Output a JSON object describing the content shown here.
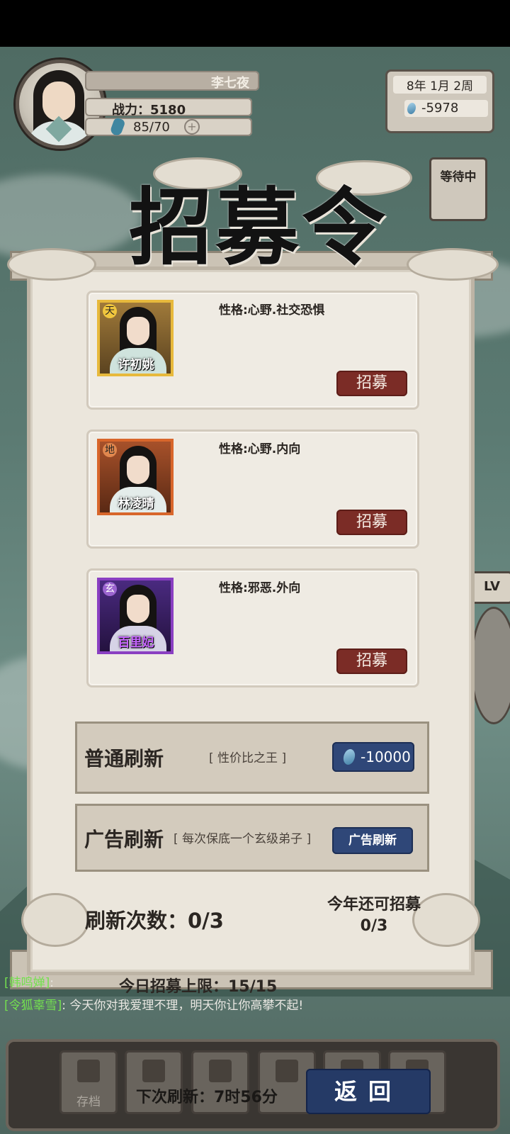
{
  "player": {
    "name": "李七夜",
    "power": "战力：5180",
    "stamina": "85/70",
    "stamina_plus": "+"
  },
  "date": "8年   1月  2周",
  "spirit_stones": "-5978",
  "waiting_label": "等待中",
  "side_level_label": "LV",
  "dialog": {
    "title": "招募令",
    "candidates": [
      {
        "tier": "天",
        "name": "许初姚",
        "trait": "性格:心野.社交恐惧",
        "button": "招募",
        "tier_color": "#e0b52a",
        "robe": "#cfe3dd"
      },
      {
        "tier": "地",
        "name": "林凌晴",
        "trait": "性格:心野.内向",
        "button": "招募",
        "tier_color": "#d8662b",
        "robe": "#e4ecea"
      },
      {
        "tier": "玄",
        "name": "百里妃",
        "trait": "性格:邪恶.外向",
        "button": "招募",
        "tier_color": "#8a3fc2",
        "robe": "#d6d3e6"
      }
    ],
    "normal_refresh": {
      "label": "普通刷新",
      "note": "[ 性价比之王 ]",
      "cost": "-10000"
    },
    "ad_refresh": {
      "label": "广告刷新",
      "note": "[ 每次保底一个玄级弟子 ]",
      "button": "广告刷新"
    },
    "refresh_count": "刷新次数：0/3",
    "year_remaining": "今年还可招募0/3",
    "daily_limit": "今日招募上限：15/15"
  },
  "chat": [
    {
      "name": "[韩鸣婵]",
      "text": ":"
    },
    {
      "name": "[令狐辜雪]",
      "text": ": 今天你对我爱理不理，明天你让你高攀不起!"
    }
  ],
  "toolbar": {
    "items": [
      "存档",
      "",
      "",
      "",
      "",
      ""
    ],
    "next_refresh": "下次刷新：7时56分",
    "back": "返回"
  }
}
